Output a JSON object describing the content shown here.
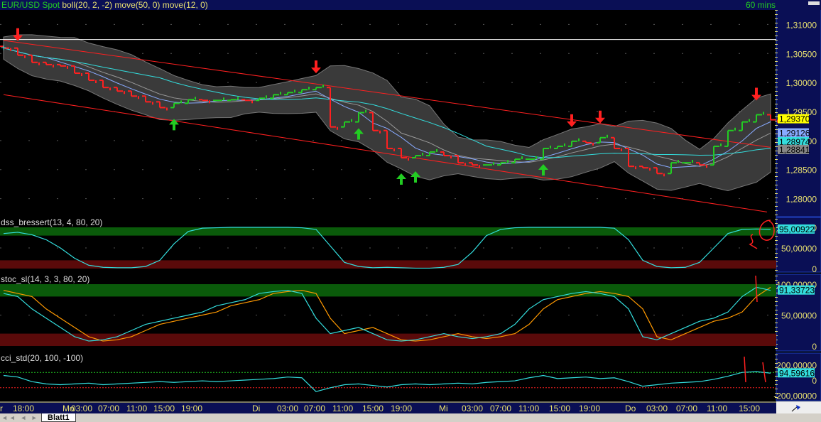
{
  "title": {
    "symbol": "EUR/USD Spot",
    "indicators": "boll(20, 2, -2) move(50, 0) move(12, 0)",
    "interval": "60 mins"
  },
  "colors": {
    "up": "#22cc22",
    "down": "#ff2020",
    "ma_slow": "#33dddd",
    "ma_fast": "#88aaff",
    "band": "#3a3a3a",
    "axis_bg": "#0a0f55",
    "axis_text": "#e8e070"
  },
  "chart_data": [
    {
      "type": "line",
      "name": "price",
      "ylim": [
        1.2775,
        1.3125
      ],
      "yticks": [
        "1,28000",
        "1,28500",
        "1,29000",
        "1,29500",
        "1,30000",
        "1,30500",
        "1,31000"
      ],
      "ytick_values": [
        1.28,
        1.285,
        1.29,
        1.295,
        1.3,
        1.305,
        1.31
      ],
      "closes": [
        1.30593,
        1.3047,
        1.30347,
        1.30309,
        1.30285,
        1.30161,
        1.30038,
        1.29914,
        1.29852,
        1.29766,
        1.29667,
        1.29568,
        1.29642,
        1.29704,
        1.29692,
        1.29692,
        1.29704,
        1.29692,
        1.29729,
        1.2979,
        1.29827,
        1.29877,
        1.29914,
        1.29235,
        1.29321,
        1.29482,
        1.29173,
        1.28864,
        1.28704,
        1.28741,
        1.28803,
        1.28741,
        1.28617,
        1.2858,
        1.2858,
        1.28617,
        1.28679,
        1.28679,
        1.28864,
        1.28901,
        1.28988,
        1.28963,
        1.2905,
        1.28864,
        1.28556,
        1.28531,
        1.28432,
        1.28617,
        1.28617,
        1.2858,
        1.28901,
        1.29173,
        1.29321,
        1.29445,
        1.29358
      ],
      "last_labels": [
        {
          "text": "1,29370",
          "value": 1.2937,
          "bg": "#ffff00"
        },
        {
          "text": "1,29126",
          "value": 1.29126,
          "bg": "#88aaff"
        },
        {
          "text": "1,28974",
          "value": 1.28974,
          "bg": "#33dddd"
        },
        {
          "text": "1,28841",
          "value": 1.28841,
          "bg": "#888888"
        }
      ],
      "horizontal_line": 1.3074,
      "channel_upper": [
        1.30725,
        1.28883
      ],
      "channel_lower": [
        1.2979,
        1.2777
      ],
      "arrows": [
        {
          "dir": "down",
          "i": 1
        },
        {
          "dir": "down",
          "i": 22
        },
        {
          "dir": "down",
          "i": 40
        },
        {
          "dir": "down",
          "i": 42
        },
        {
          "dir": "down",
          "i": 53
        },
        {
          "dir": "up",
          "i": 12
        },
        {
          "dir": "up",
          "i": 25
        },
        {
          "dir": "up",
          "i": 28
        },
        {
          "dir": "up",
          "i": 29
        },
        {
          "dir": "up",
          "i": 38
        }
      ]
    },
    {
      "type": "line",
      "name": "dss",
      "title": "dss_bressert(13, 4, 80, 20)",
      "ylim": [
        0,
        100
      ],
      "yticks": [
        "0",
        "50,00000",
        "100,00000"
      ],
      "last_label": "95,00922",
      "values": [
        85,
        88,
        82,
        70,
        50,
        25,
        8,
        3,
        2,
        2,
        5,
        20,
        60,
        90,
        98,
        99,
        100,
        100,
        100,
        100,
        100,
        99,
        95,
        55,
        15,
        5,
        2,
        3,
        2,
        1,
        1,
        3,
        10,
        40,
        80,
        95,
        99,
        100,
        100,
        100,
        100,
        100,
        100,
        98,
        70,
        20,
        5,
        2,
        3,
        15,
        50,
        85,
        95,
        96,
        95
      ]
    },
    {
      "type": "line",
      "name": "stoc",
      "title": "stoc_sl(14, 3, 3, 80, 20)",
      "ylim": [
        0,
        100
      ],
      "yticks": [
        "0",
        "50,00000",
        "100,00000"
      ],
      "last_label": "91,33723",
      "series": [
        {
          "name": "main",
          "values": [
            85,
            80,
            60,
            45,
            30,
            15,
            8,
            10,
            15,
            25,
            35,
            40,
            45,
            50,
            55,
            65,
            70,
            75,
            85,
            88,
            90,
            85,
            45,
            20,
            25,
            30,
            20,
            10,
            8,
            10,
            15,
            20,
            15,
            12,
            15,
            20,
            35,
            60,
            75,
            80,
            85,
            88,
            85,
            80,
            60,
            15,
            10,
            20,
            30,
            40,
            45,
            55,
            80,
            95,
            90
          ]
        },
        {
          "name": "signal",
          "values": [
            90,
            85,
            80,
            60,
            45,
            30,
            15,
            8,
            10,
            15,
            25,
            35,
            40,
            45,
            50,
            55,
            65,
            70,
            75,
            85,
            88,
            90,
            85,
            45,
            20,
            25,
            30,
            20,
            10,
            8,
            10,
            15,
            20,
            15,
            12,
            15,
            20,
            35,
            60,
            75,
            80,
            85,
            88,
            85,
            80,
            60,
            15,
            10,
            20,
            30,
            40,
            45,
            55,
            80,
            95
          ]
        }
      ]
    },
    {
      "type": "line",
      "name": "cci",
      "title": "cci_std(20, 100, -100)",
      "ylim": [
        -250,
        250
      ],
      "yticks": [
        "-200,00000",
        "0",
        "200,00000"
      ],
      "last_label": "94,59616",
      "values": [
        60,
        40,
        -20,
        -50,
        -60,
        -50,
        -40,
        -60,
        -50,
        -40,
        -30,
        -20,
        -30,
        -20,
        -10,
        -20,
        -10,
        0,
        10,
        20,
        40,
        30,
        -150,
        -100,
        -60,
        -50,
        -70,
        -90,
        -60,
        -50,
        -60,
        -50,
        -40,
        -50,
        -30,
        -20,
        -10,
        30,
        60,
        20,
        30,
        40,
        20,
        30,
        -20,
        -80,
        -60,
        -40,
        -30,
        -20,
        10,
        50,
        100,
        110,
        90
      ]
    }
  ],
  "xaxis": [
    "r",
    "18:00",
    "Mo",
    "03:00",
    "07:00",
    "11:00",
    "15:00",
    "19:00",
    "Di",
    "03:00",
    "07:00",
    "11:00",
    "15:00",
    "19:00",
    "Mi",
    "03:00",
    "07:00",
    "11:00",
    "15:00",
    "19:00",
    "Do",
    "03:00",
    "07:00",
    "11:00",
    "15:00"
  ],
  "sheet_tab": "Blatt1",
  "sheet_nav": "◄◄ ◄ ► ►►"
}
